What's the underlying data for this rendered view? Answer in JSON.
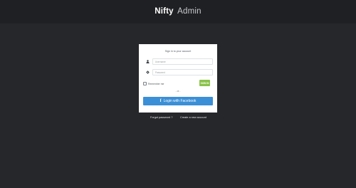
{
  "brand": {
    "name_bold": "Nifty",
    "name_light": "Admin"
  },
  "login": {
    "title": "Sign in to your account",
    "username_placeholder": "Username",
    "password_placeholder": "Password",
    "remember_label": "Remember me",
    "signin_label": "SIGN IN",
    "or_text": "- or -",
    "facebook_label": "Login with Facebook",
    "facebook_icon": "f"
  },
  "footer_links": {
    "forgot": "Forgot password ?",
    "create": "Create a new account"
  },
  "colors": {
    "background": "#26272b",
    "topbar": "#1f2023",
    "signin": "#8bc34a",
    "facebook": "#3b8fd6"
  }
}
